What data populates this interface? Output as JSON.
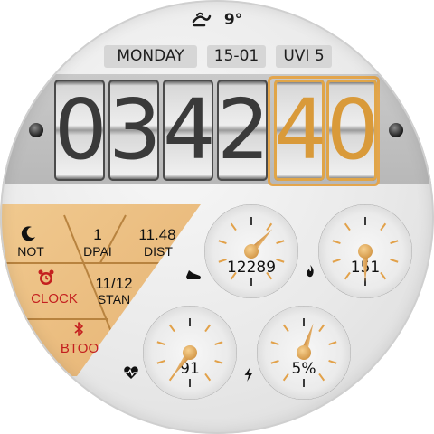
{
  "weather": {
    "temperature": "9°",
    "icon": "wind-icon"
  },
  "day": "MONDAY",
  "date": "15-01",
  "uvi": "UVI 5",
  "time": {
    "hh": [
      "0",
      "3"
    ],
    "mm": [
      "4",
      "2"
    ],
    "ss": [
      "4",
      "0"
    ]
  },
  "colors": {
    "accent": "#e3a54c",
    "alert": "#c41f1f",
    "panel": "#eabd7f"
  },
  "status": {
    "not": {
      "label": "NOT",
      "icon": "moon-icon"
    },
    "dpai": {
      "value": "1",
      "label": "DPAI"
    },
    "dist": {
      "value": "11.48",
      "label": "DIST"
    },
    "clock": {
      "label": "CLOCK",
      "icon": "alarm-clock-icon"
    },
    "stan": {
      "value": "11/12",
      "label": "STAN"
    },
    "btoo": {
      "label": "BTOO",
      "icon": "bluetooth-icon"
    }
  },
  "gauges": [
    {
      "name": "steps",
      "value": "12289",
      "icon": "shoe-icon",
      "level": 0.12
    },
    {
      "name": "calories",
      "value": "151",
      "icon": "flame-icon",
      "level": 0.5
    },
    {
      "name": "heart-rate",
      "value": "91",
      "icon": "heart-pulse-icon",
      "level": 0.6
    },
    {
      "name": "battery",
      "value": "5%",
      "icon": "lightning-icon",
      "level": 0.05
    }
  ]
}
